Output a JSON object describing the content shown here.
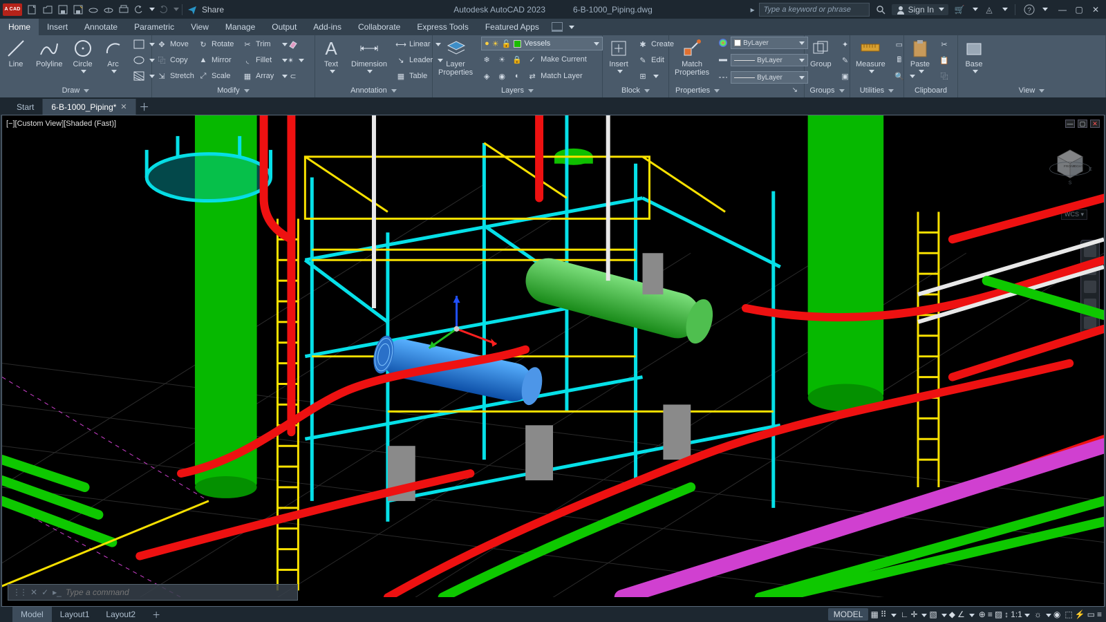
{
  "titlebar": {
    "logo": "A CAD",
    "share": "Share",
    "app_name": "Autodesk AutoCAD 2023",
    "doc_name": "6-B-1000_Piping.dwg",
    "search_placeholder": "Type a keyword or phrase",
    "signin": "Sign In"
  },
  "menubar": {
    "tabs": [
      "Home",
      "Insert",
      "Annotate",
      "Parametric",
      "View",
      "Manage",
      "Output",
      "Add-ins",
      "Collaborate",
      "Express Tools",
      "Featured Apps"
    ],
    "active": 0
  },
  "ribbon": {
    "draw": {
      "title": "Draw",
      "line": "Line",
      "polyline": "Polyline",
      "circle": "Circle",
      "arc": "Arc"
    },
    "modify": {
      "title": "Modify",
      "move": "Move",
      "rotate": "Rotate",
      "trim": "Trim",
      "copy": "Copy",
      "mirror": "Mirror",
      "fillet": "Fillet",
      "stretch": "Stretch",
      "scale": "Scale",
      "array": "Array"
    },
    "annotation": {
      "title": "Annotation",
      "text": "Text",
      "dimension": "Dimension",
      "linear": "Linear",
      "leader": "Leader",
      "table": "Table"
    },
    "layers": {
      "title": "Layers",
      "properties": "Layer\nProperties",
      "selected": "Vessels",
      "make_current": "Make Current",
      "match": "Match Layer"
    },
    "block": {
      "title": "Block",
      "insert": "Insert",
      "create": "Create",
      "edit": "Edit",
      "edit_attr": ""
    },
    "properties": {
      "title": "Properties",
      "match": "Match\nProperties",
      "bylayer": "ByLayer"
    },
    "groups": {
      "title": "Groups",
      "group": "Group"
    },
    "utilities": {
      "title": "Utilities",
      "measure": "Measure"
    },
    "clipboard": {
      "title": "Clipboard",
      "paste": "Paste"
    },
    "view": {
      "title": "View",
      "base": "Base"
    }
  },
  "doctabs": {
    "start": "Start",
    "file": "6-B-1000_Piping*"
  },
  "viewport": {
    "label": "[−][Custom View][Shaded (Fast)]",
    "wcs": "WCS",
    "cube_front": "FRONT",
    "cube_right": "RIGHT"
  },
  "cmd": {
    "placeholder": "Type a command"
  },
  "bottom": {
    "model": "Model",
    "layout1": "Layout1",
    "layout2": "Layout2"
  },
  "status": {
    "model": "MODEL",
    "scale": "1:1"
  }
}
